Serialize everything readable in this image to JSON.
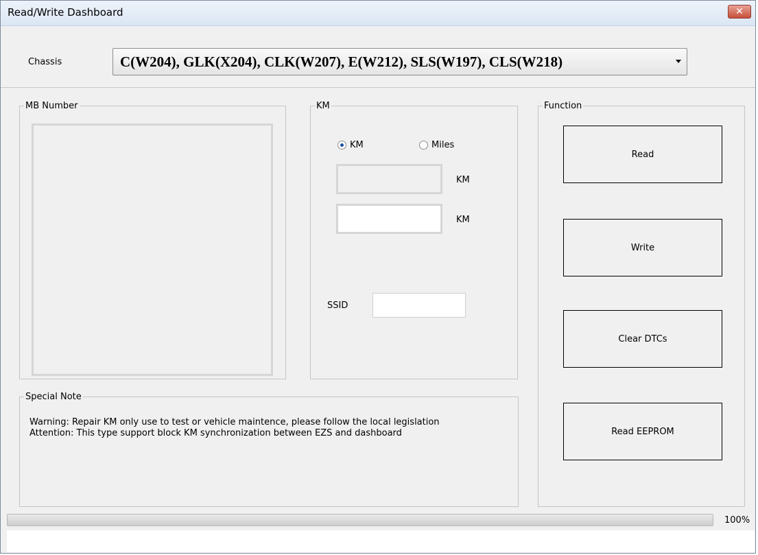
{
  "window": {
    "title": "Read/Write Dashboard",
    "close_glyph": "✕"
  },
  "chassis": {
    "label": "Chassis",
    "selected": "C(W204), GLK(X204), CLK(W207), E(W212), SLS(W197), CLS(W218)"
  },
  "mb_number": {
    "legend": "MB Number"
  },
  "km": {
    "legend": "KM",
    "radio_km": {
      "label": "KM",
      "checked": true
    },
    "radio_miles": {
      "label": "Miles",
      "checked": false
    },
    "unit_current": "KM",
    "unit_new": "KM",
    "ssid_label": "SSID",
    "current_value": "",
    "new_value": "",
    "ssid_value": ""
  },
  "function": {
    "legend": "Function",
    "read_label": "Read",
    "write_label": "Write",
    "clear_dtcs_label": "Clear DTCs",
    "read_eeprom_label": "Read EEPROM"
  },
  "special_note": {
    "legend": "Special Note",
    "warning": "Warning: Repair KM only use to test or vehicle maintence, please follow the local legislation",
    "attention": "Attention: This type support block KM synchronization between EZS and dashboard"
  },
  "progress": {
    "value_percent": 100,
    "label": "100%"
  },
  "colors": {
    "window_bg": "#f0f0f0",
    "close_button": "#c7503a",
    "radio_selected": "#1c4fa3"
  }
}
